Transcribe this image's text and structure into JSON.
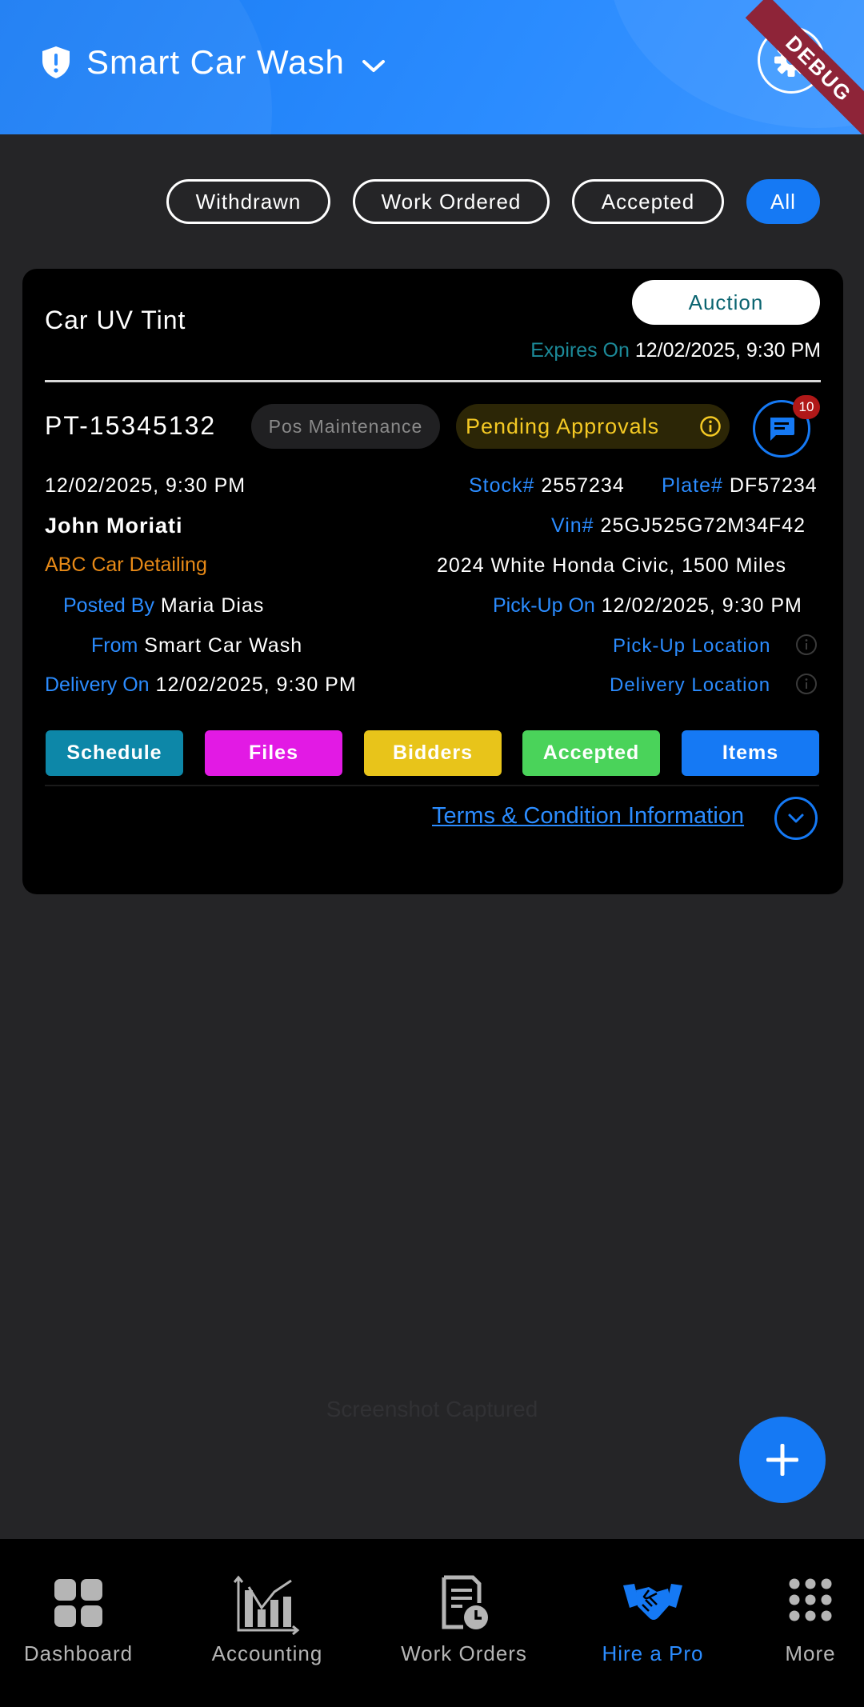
{
  "header": {
    "title": "Smart Car Wash",
    "ribbon": "DEBUG",
    "icons": {
      "shield": "shield-alert-icon",
      "dropdown": "chevron-down-icon",
      "settings": "gear-icon"
    }
  },
  "filters": [
    {
      "label": "Withdrawn",
      "active": false
    },
    {
      "label": "Work Ordered",
      "active": false
    },
    {
      "label": "Accepted",
      "active": false
    },
    {
      "label": "All",
      "active": true
    }
  ],
  "card": {
    "title": "Car UV Tint",
    "type_pill": "Auction",
    "expires_label": "Expires On",
    "expires_value": "12/02/2025, 9:30 PM",
    "job_id": "PT-15345132",
    "category": "Pos Maintenance",
    "status": "Pending Approvals",
    "chat_count": "10",
    "date": "12/02/2025, 9:30 PM",
    "stock_label": "Stock#",
    "stock_value": "2557234",
    "plate_label": "Plate#",
    "plate_value": "DF57234",
    "customer": "John Moriati",
    "vin_label": "Vin#",
    "vin_value": "25GJ525G72M34F42",
    "company": "ABC Car Detailing",
    "vehicle": "2024 White Honda Civic, 1500 Miles",
    "posted_by_label": "Posted By",
    "posted_by_value": "Maria Dias",
    "pickup_label": "Pick-Up On",
    "pickup_value": "12/02/2025, 9:30 PM",
    "from_label": "From",
    "from_value": "Smart Car Wash",
    "pickup_location": "Pick-Up Location",
    "delivery_label": "Delivery On",
    "delivery_value": "12/02/2025, 9:30 PM",
    "delivery_location": "Delivery Location",
    "actions": [
      {
        "label": "Schedule",
        "color": "#0d87a8"
      },
      {
        "label": "Files",
        "color": "#e21ae4"
      },
      {
        "label": "Bidders",
        "color": "#e8c41a"
      },
      {
        "label": "Accepted",
        "color": "#4ad35a"
      },
      {
        "label": "Items",
        "color": "#1579f4"
      }
    ],
    "terms": "Terms & Condition Information"
  },
  "watermark": "Screenshot Captured",
  "bottom_nav": [
    {
      "label": "Dashboard",
      "icon": "grid-icon",
      "active": false
    },
    {
      "label": "Accounting",
      "icon": "chart-icon",
      "active": false
    },
    {
      "label": "Work Orders",
      "icon": "document-clock-icon",
      "active": false
    },
    {
      "label": "Hire a Pro",
      "icon": "handshake-icon",
      "active": true
    },
    {
      "label": "More",
      "icon": "dots-grid-icon",
      "active": false
    }
  ],
  "colors": {
    "accent": "#1579f4",
    "status": "#f4c924",
    "company": "#e88a17"
  }
}
